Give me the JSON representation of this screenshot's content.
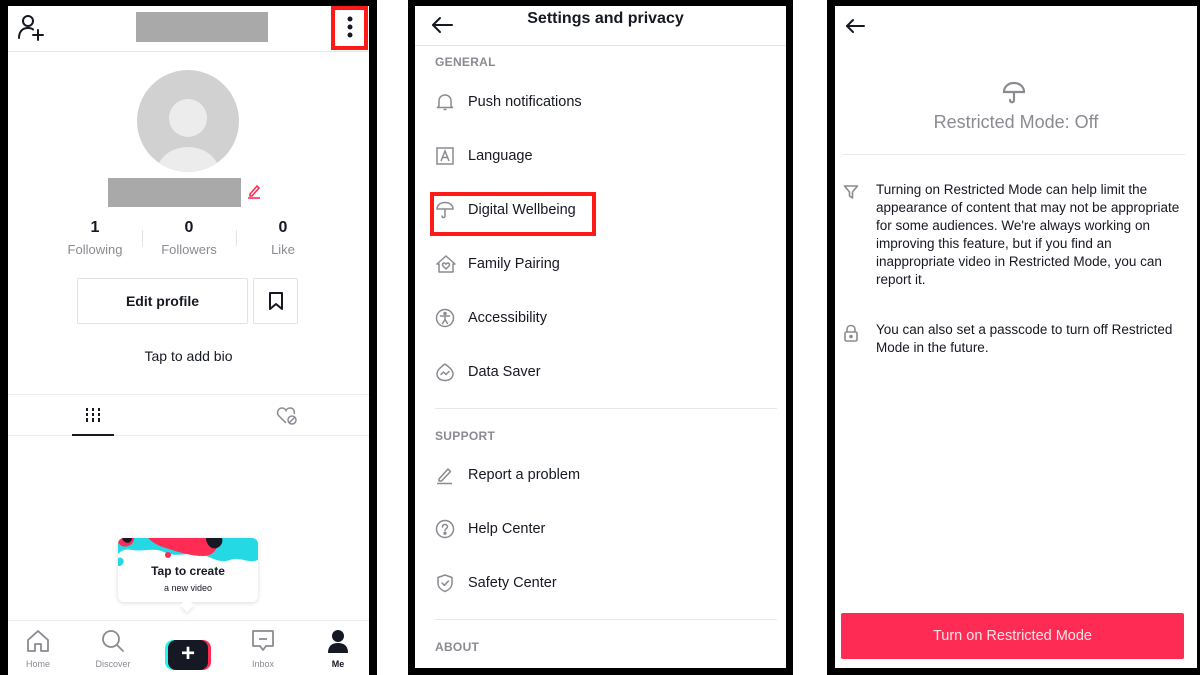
{
  "colors": {
    "brand_red": "#fe2c55",
    "brand_cyan": "#25f4ee",
    "highlight": "#ff1a1a",
    "text_primary": "#161823",
    "text_secondary": "#8a8b91"
  },
  "profile": {
    "header": {
      "add_user_icon": "add-user-icon",
      "username": "[redacted]",
      "more_icon": "more-vertical-icon",
      "more_highlighted": true
    },
    "display_name": "[redacted]",
    "stats": [
      {
        "value": "1",
        "label": "Following"
      },
      {
        "value": "0",
        "label": "Followers"
      },
      {
        "value": "0",
        "label": "Like"
      }
    ],
    "edit_profile_label": "Edit profile",
    "bookmark_icon": "bookmark-icon",
    "bio_prompt": "Tap to add bio",
    "tabs": [
      {
        "icon": "videos-grid-icon",
        "active": true
      },
      {
        "icon": "liked-hidden-icon",
        "active": false
      }
    ],
    "create_tooltip": {
      "title": "Tap to create",
      "subtitle": "a new video"
    },
    "bottom_nav": [
      {
        "label": "Home",
        "icon": "home-icon",
        "active": false
      },
      {
        "label": "Discover",
        "icon": "search-icon",
        "active": false
      },
      {
        "label": "",
        "icon": "plus-icon",
        "active": false
      },
      {
        "label": "Inbox",
        "icon": "inbox-icon",
        "active": false
      },
      {
        "label": "Me",
        "icon": "person-icon",
        "active": true
      }
    ],
    "create_symbol": "+"
  },
  "settings": {
    "title": "Settings and privacy",
    "sections": [
      {
        "label": "GENERAL",
        "items": [
          {
            "label": "Push notifications",
            "icon": "bell-icon"
          },
          {
            "label": "Language",
            "icon": "language-icon"
          },
          {
            "label": "Digital Wellbeing",
            "icon": "umbrella-icon",
            "highlighted": true
          },
          {
            "label": "Family Pairing",
            "icon": "family-pairing-icon"
          },
          {
            "label": "Accessibility",
            "icon": "accessibility-icon"
          },
          {
            "label": "Data Saver",
            "icon": "data-saver-icon"
          }
        ]
      },
      {
        "label": "SUPPORT",
        "items": [
          {
            "label": "Report a problem",
            "icon": "pencil-icon"
          },
          {
            "label": "Help Center",
            "icon": "help-icon"
          },
          {
            "label": "Safety Center",
            "icon": "shield-check-icon"
          }
        ]
      },
      {
        "label": "ABOUT",
        "items": []
      }
    ]
  },
  "restricted_mode": {
    "status": "Restricted Mode: Off",
    "info": [
      {
        "icon": "filter-icon",
        "text": "Turning on Restricted Mode can help limit the appearance of content that may not be appropriate for some audiences. We're always working on improving this feature, but if you find an inappropriate video in Restricted Mode, you can report it."
      },
      {
        "icon": "lock-icon",
        "text": "You can also set a passcode to turn off Restricted Mode in the future."
      }
    ],
    "button_label": "Turn on Restricted Mode"
  }
}
